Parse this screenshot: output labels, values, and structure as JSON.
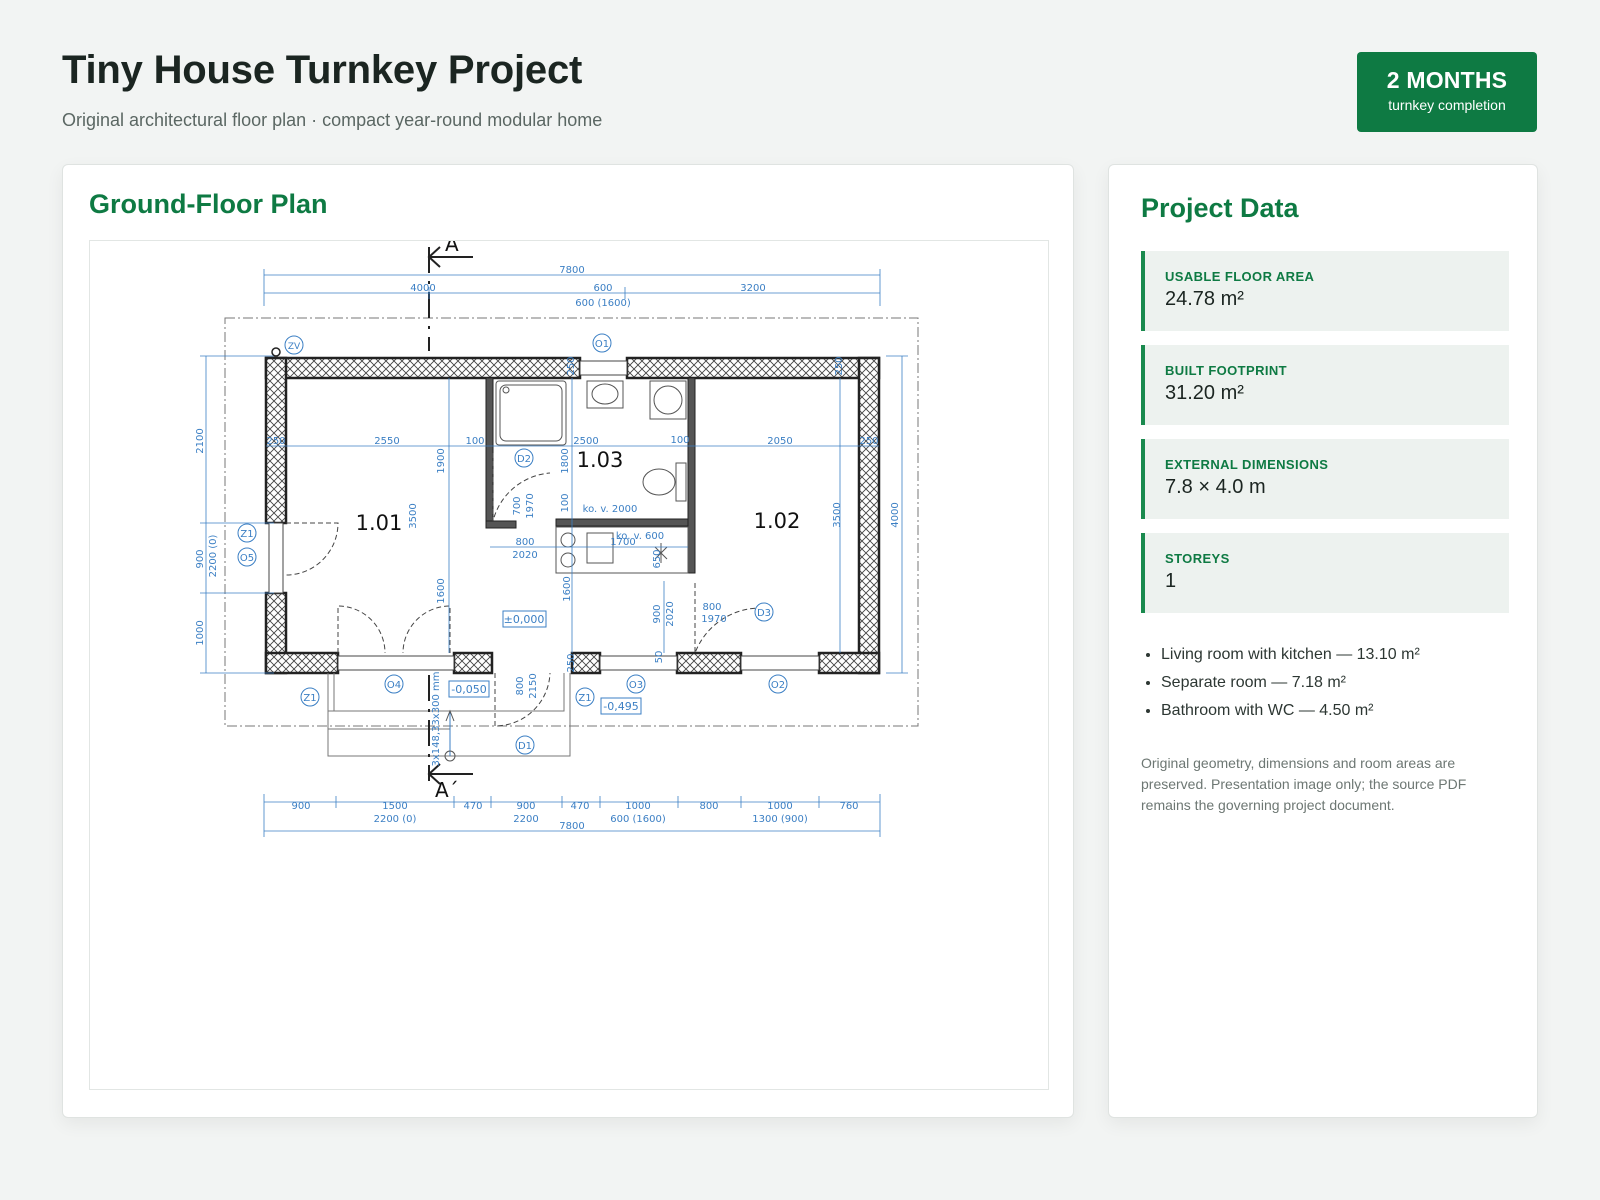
{
  "header": {
    "title": "Tiny House Turnkey Project",
    "subtitle": "Original architectural floor plan · compact year-round modular home",
    "badge_big": "2 MONTHS",
    "badge_small": "turnkey completion"
  },
  "plan": {
    "heading": "Ground-Floor Plan",
    "rooms": {
      "living": "1.01",
      "room": "1.02",
      "bath": "1.03"
    },
    "section_marks": [
      "A",
      "A´"
    ],
    "top_dims": {
      "overall": "7800",
      "d1": "4000",
      "d2": "600",
      "d2b": "600 (1600)",
      "d3": "3200"
    },
    "bottom_dims": {
      "segments": [
        "900",
        "1500",
        "470",
        "900",
        "470",
        "1000",
        "800",
        "1000",
        "760"
      ],
      "sub": [
        "2200 (0)",
        "2200",
        "600 (1600)",
        "1300 (900)"
      ],
      "overall": "7800"
    },
    "left_dims": [
      "2100",
      "900",
      "2200 (0)",
      "1000"
    ],
    "right_dims": [
      "3500",
      "4000"
    ],
    "internal_dims": {
      "w250a": "250",
      "w2550": "2550",
      "w100a": "100",
      "w2500": "2500",
      "w100b": "100",
      "w2050": "2050",
      "w250b": "250",
      "v1900": "1900",
      "v3500": "3500",
      "v1600a": "1600",
      "v1800": "1800",
      "v100": "100",
      "v700": "700",
      "v1970": "1970",
      "d800": "800",
      "d2020": "2020",
      "k1700": "1700",
      "v1600b": "1600",
      "v650": "650",
      "v900": "900",
      "v2020": "2020",
      "d800b": "800",
      "d1970b": "1970",
      "v250a": "250",
      "v250b": "250",
      "v250c": "250",
      "v50": "50",
      "v800": "800",
      "v2150": "2150",
      "stairs": "3x148,33x300 mm"
    },
    "notes": {
      "ko1": "ko. v. 2000",
      "ko2": "ko. v. 600"
    },
    "levels": {
      "floor": "±0,000",
      "step": "-0,050",
      "ground": "-0,495"
    },
    "tags": {
      "zv": "ZV",
      "o1": "O1",
      "o2": "O2",
      "o3": "O3",
      "o4": "O4",
      "o5": "O5",
      "z1a": "Z1",
      "z1b": "Z1",
      "z1c": "Z1",
      "d1": "D1",
      "d2": "D2",
      "d3": "D3"
    }
  },
  "project": {
    "heading": "Project Data",
    "stats": [
      {
        "label": "USABLE FLOOR AREA",
        "value": "24.78 m²"
      },
      {
        "label": "BUILT FOOTPRINT",
        "value": "31.20 m²"
      },
      {
        "label": "EXTERNAL DIMENSIONS",
        "value": "7.8 × 4.0 m"
      },
      {
        "label": "STOREYS",
        "value": "1"
      }
    ],
    "rooms": [
      "Living room with kitchen — 13.10 m²",
      "Separate room — 7.18 m²",
      "Bathroom with WC — 4.50 m²"
    ],
    "note": "Original geometry, dimensions and room areas are preserved. Presentation image only; the source PDF remains the governing project document."
  },
  "colors": {
    "accent": "#0e7a43",
    "dimension": "#3b7fc4",
    "wall": "#2a2a2a"
  }
}
